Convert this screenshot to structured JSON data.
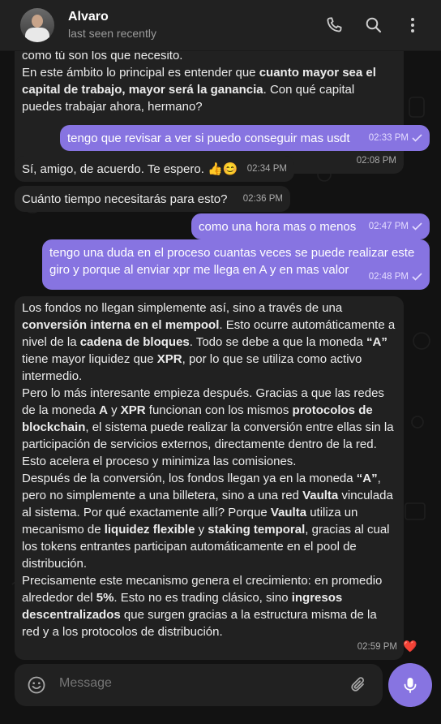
{
  "header": {
    "contact_name": "Alvaro",
    "status": "last seen recently",
    "icons": [
      "phone-icon",
      "search-icon",
      "more-vertical-icon"
    ]
  },
  "messages": [
    {
      "id": "m1",
      "direction": "incoming",
      "lines": [
        "como tú son los que necesito.",
        "En este ámbito lo principal es entender que cuanto mayor sea el capital de trabajo, mayor será la ganancia. Con qué capital puedes trabajar ahora, hermano?"
      ],
      "bold_phrases": [
        "cuanto mayor sea el capital de trabajo, mayor será la ganancia"
      ],
      "time": "02:08 PM"
    },
    {
      "id": "m2",
      "direction": "outgoing",
      "text": "tengo que revisar a ver si puedo conseguir mas usdt",
      "time": "02:33 PM",
      "read": true
    },
    {
      "id": "m3",
      "direction": "incoming",
      "text": "Sí, amigo, de acuerdo. Te espero. 👍😊",
      "time": "02:34 PM"
    },
    {
      "id": "m4",
      "direction": "incoming",
      "text": "Cuánto tiempo necesitarás para esto?",
      "time": "02:36 PM"
    },
    {
      "id": "m5",
      "direction": "outgoing",
      "text": "como una hora mas o menos",
      "time": "02:47 PM",
      "read": true
    },
    {
      "id": "m6",
      "direction": "outgoing",
      "text": "tengo una duda en el proceso cuantas veces se puede realizar este giro y porque al enviar xpr me llega en A y en mas valor",
      "time": "02:48 PM",
      "read": true
    },
    {
      "id": "m7",
      "direction": "incoming",
      "paragraphs": [
        "Los fondos no llegan simplemente así, sino a través de una conversión interna en el mempool. Esto ocurre automáticamente a nivel de la cadena de bloques. Todo se debe a que la moneda “A” tiene mayor liquidez que XPR, por lo que se utiliza como activo intermedio.",
        "Pero lo más interesante empieza después. Gracias a que las redes de la moneda A y XPR funcionan con los mismos protocolos de blockchain, el sistema puede realizar la conversión entre ellas sin la participación de servicios externos, directamente dentro de la red. Esto acelera el proceso y minimiza las comisiones.",
        "Después de la conversión, los fondos llegan ya en la moneda “A”, pero no simplemente a una billetera, sino a una red Vaulta vinculada al sistema. Por qué exactamente allí? Porque Vaulta utiliza un mecanismo de liquidez flexible y staking temporal, gracias al cual los tokens entrantes participan automáticamente en el pool de distribución.",
        "Precisamente este mecanismo genera el crecimiento: en promedio alrededor del 5%. Esto no es trading clásico, sino ingresos descentralizados que surgen gracias a la estructura misma de la red y a los protocolos de distribución."
      ],
      "bold_phrases": [
        "conversión interna en el mempool",
        "cadena de bloques",
        "“A”",
        "XPR",
        "A",
        "protocolos de blockchain",
        "Vaulta",
        "liquidez flexible",
        "staking temporal",
        "5%",
        "ingresos descentralizados"
      ],
      "time": "02:59 PM",
      "reaction": "❤️"
    }
  ],
  "composer": {
    "placeholder": "Message",
    "icons": [
      "emoji-icon",
      "attach-icon",
      "mic-icon"
    ]
  },
  "colors": {
    "accent": "#8774e1",
    "incoming_bubble": "#212121",
    "background": "#121212",
    "header": "#212121"
  }
}
